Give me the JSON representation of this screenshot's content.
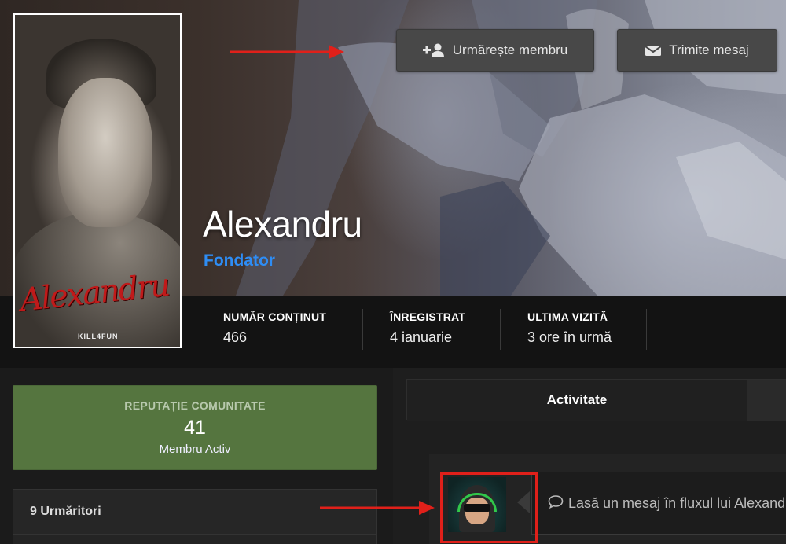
{
  "profile": {
    "name": "Alexandru",
    "group": "Fondator",
    "avatar_signature": "Alexandru",
    "avatar_tag": "KILL4FUN"
  },
  "actions": {
    "follow_label": "Urmărește membru",
    "message_label": "Trimite mesaj"
  },
  "stats": [
    {
      "label": "NUMĂR CONȚINUT",
      "value": "466"
    },
    {
      "label": "ÎNREGISTRAT",
      "value": "4 ianuarie"
    },
    {
      "label": "ULTIMA VIZITĂ",
      "value": "3 ore în urmă"
    }
  ],
  "reputation": {
    "title": "REPUTAȚIE COMUNITATE",
    "points": "41",
    "rank": "Membru Activ"
  },
  "followers": {
    "title": "9 Urmăritori"
  },
  "tabs": {
    "active": "Activitate"
  },
  "status_update": {
    "placeholder": "Lasă un mesaj în fluxul lui Alexandru"
  },
  "colors": {
    "group": "#2e8df5",
    "reputation_bg": "#55753f",
    "annotation": "#e0201a"
  }
}
